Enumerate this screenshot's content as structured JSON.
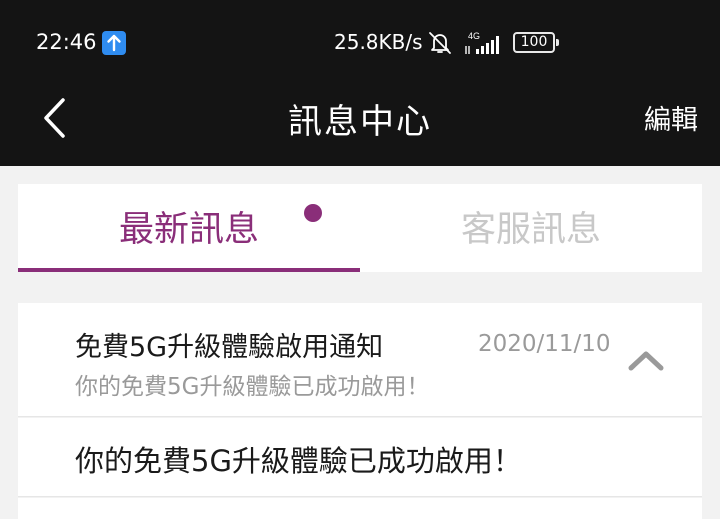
{
  "status_bar": {
    "time": "22:46",
    "network_speed": "25.8KB/s",
    "network_type": "4G",
    "battery": "100",
    "upload_icon": "upload-arrow-icon",
    "mute_icon": "bell-off-icon",
    "signal_icon": "signal-icon"
  },
  "app_bar": {
    "title": "訊息中心",
    "edit_label": "編輯",
    "back_icon": "chevron-left-icon"
  },
  "tabs": [
    {
      "label": "最新訊息",
      "active": true,
      "unread": true
    },
    {
      "label": "客服訊息",
      "active": false
    }
  ],
  "messages": [
    {
      "title": "免費5G升級體驗啟用通知",
      "date": "2020/11/10",
      "preview": "你的免費5G升級體驗已成功啟用！",
      "expanded": true,
      "body": "你的免費5G升級體驗已成功啟用！"
    }
  ],
  "colors": {
    "accent": "#8a2e79",
    "bar_background": "#141414",
    "page_background": "#f2f2f2",
    "upload_badge": "#2f8cf0"
  }
}
